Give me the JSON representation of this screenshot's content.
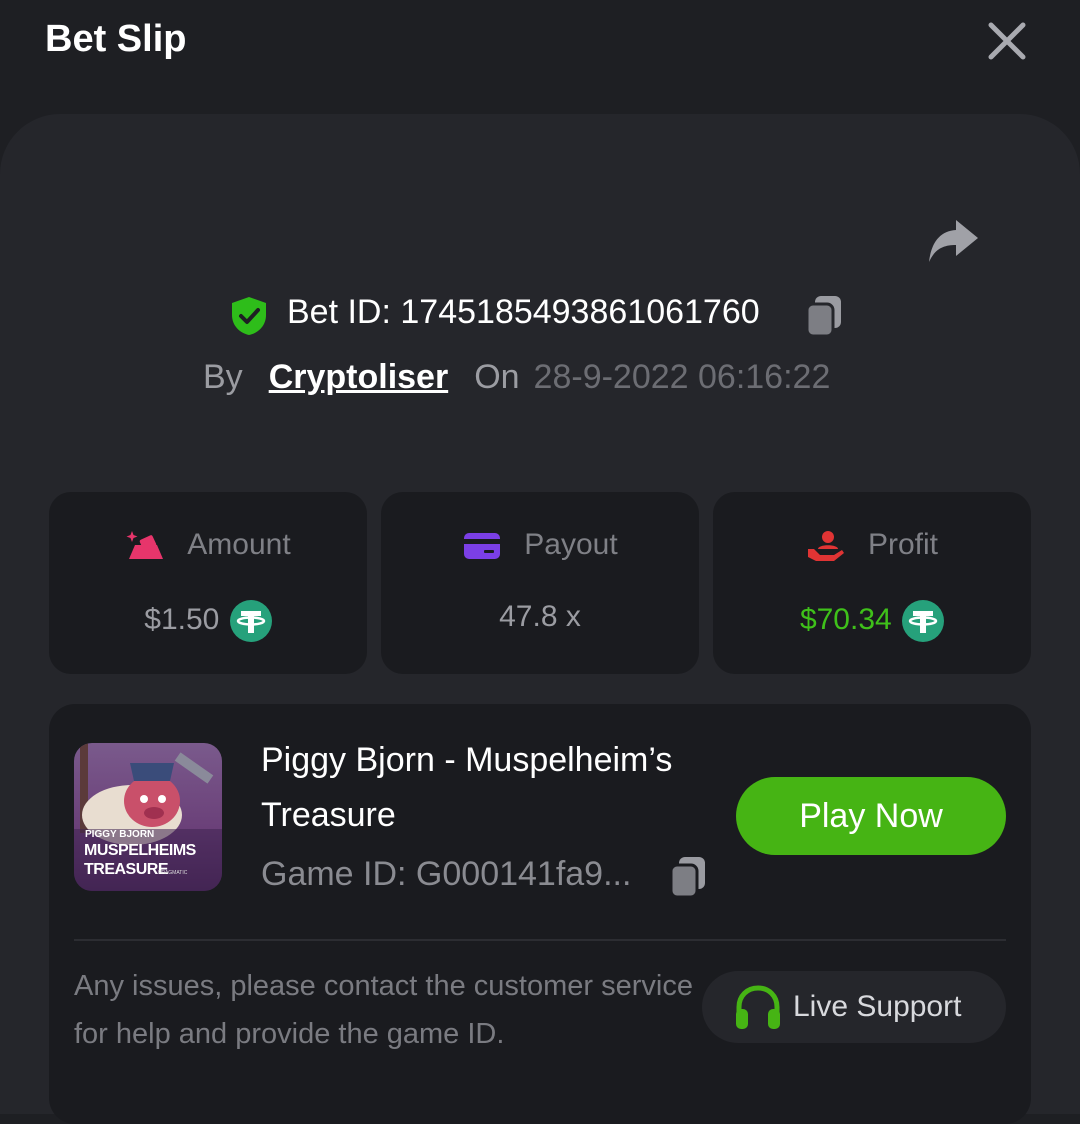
{
  "header": {
    "title": "Bet Slip",
    "close_icon": "close-icon"
  },
  "bet": {
    "id_text": "Bet ID: 1745185493861061760",
    "by_label": "By",
    "username": "Cryptoliser",
    "on_label": "On",
    "date": "28-9-2022 06:16:22"
  },
  "stats": [
    {
      "label": "Amount",
      "value": "$1.50",
      "icon": "amount-icon",
      "color": "#e7356b",
      "value_color": "#9b9ca2"
    },
    {
      "label": "Payout",
      "value": "47.8 x",
      "icon": "card-icon",
      "color": "#7b3fe6",
      "value_color": "#9b9ca2"
    },
    {
      "label": "Profit",
      "value": "$70.34",
      "icon": "profit-icon",
      "color": "#e03434",
      "value_color": "#3fc11a"
    }
  ],
  "game": {
    "name": "Piggy Bjorn - Muspelheim’s Treasure",
    "game_id": "Game ID: G000141fa9...",
    "play_label": "Play Now",
    "thumb_text": [
      "PIGGY BJORN",
      "MUSPELHEIMS",
      "TREASURE"
    ],
    "thumb_brand": "PRAGMATIC"
  },
  "support": {
    "issue_text": "Any issues, please contact the customer service for help and provide the game ID.",
    "button_label": "Live Support"
  },
  "colors": {
    "background": "#1e1f23",
    "panel": "#25262b",
    "card": "#1a1b1f",
    "accent_green": "#46b414",
    "tether": "#26a17b",
    "shield": "#2ebd1a"
  }
}
